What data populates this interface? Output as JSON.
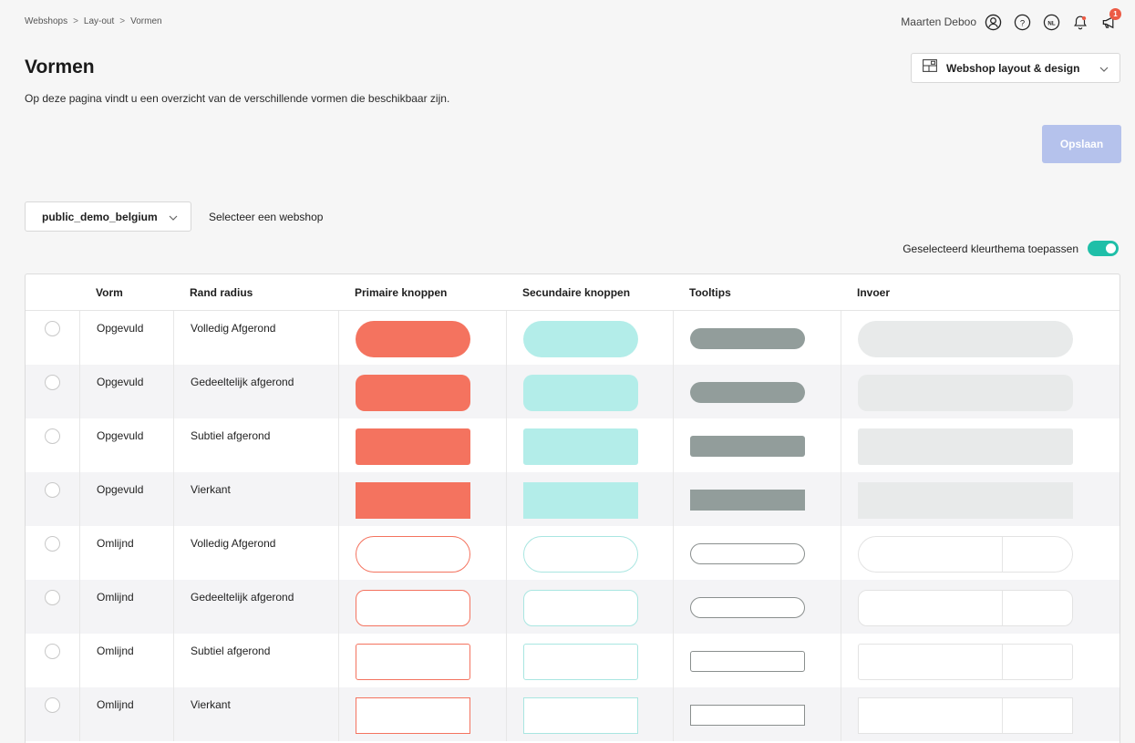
{
  "breadcrumb": [
    "Webshops",
    "Lay-out",
    "Vormen"
  ],
  "breadcrumb_sep": ">",
  "user": {
    "name": "Maarten Deboo",
    "language": "NL",
    "notification_count": "1"
  },
  "page": {
    "title": "Vormen",
    "description": "Op deze pagina vindt u een overzicht van de verschillende vormen die beschikbaar zijn."
  },
  "layout_select": {
    "label": "Webshop layout & design"
  },
  "save_label": "Opslaan",
  "shop_select": {
    "value": "public_demo_belgium",
    "hint": "Selecteer een webshop"
  },
  "theme_toggle": {
    "label": "Geselecteerd kleurthema toepassen",
    "on": true
  },
  "colors": {
    "primary": "#f4735f",
    "secondary": "#b3ede9",
    "tooltip": "#929d9b",
    "input": "#e8eaea",
    "primary_outline": "#f4735f",
    "secondary_outline": "#a9e6e1",
    "tooltip_outline": "#8a8f8e",
    "input_outline": "#e3e3e3",
    "accent_toggle": "#1fbfa8",
    "save_disabled": "#b5c2ec"
  },
  "table": {
    "headers": [
      "",
      "Vorm",
      "Rand radius",
      "Primaire knoppen",
      "Secundaire knoppen",
      "Tooltips",
      "Invoer"
    ],
    "rows": [
      {
        "vorm": "Opgevuld",
        "radius": "Volledig Afgerond",
        "style": "filled",
        "shape": "full"
      },
      {
        "vorm": "Opgevuld",
        "radius": "Gedeeltelijk afgerond",
        "style": "filled",
        "shape": "partial"
      },
      {
        "vorm": "Opgevuld",
        "radius": "Subtiel afgerond",
        "style": "filled",
        "shape": "subtle"
      },
      {
        "vorm": "Opgevuld",
        "radius": "Vierkant",
        "style": "filled",
        "shape": "square"
      },
      {
        "vorm": "Omlijnd",
        "radius": "Volledig Afgerond",
        "style": "outline",
        "shape": "full"
      },
      {
        "vorm": "Omlijnd",
        "radius": "Gedeeltelijk afgerond",
        "style": "outline",
        "shape": "partial"
      },
      {
        "vorm": "Omlijnd",
        "radius": "Subtiel afgerond",
        "style": "outline",
        "shape": "subtle"
      },
      {
        "vorm": "Omlijnd",
        "radius": "Vierkant",
        "style": "outline",
        "shape": "square"
      }
    ]
  }
}
